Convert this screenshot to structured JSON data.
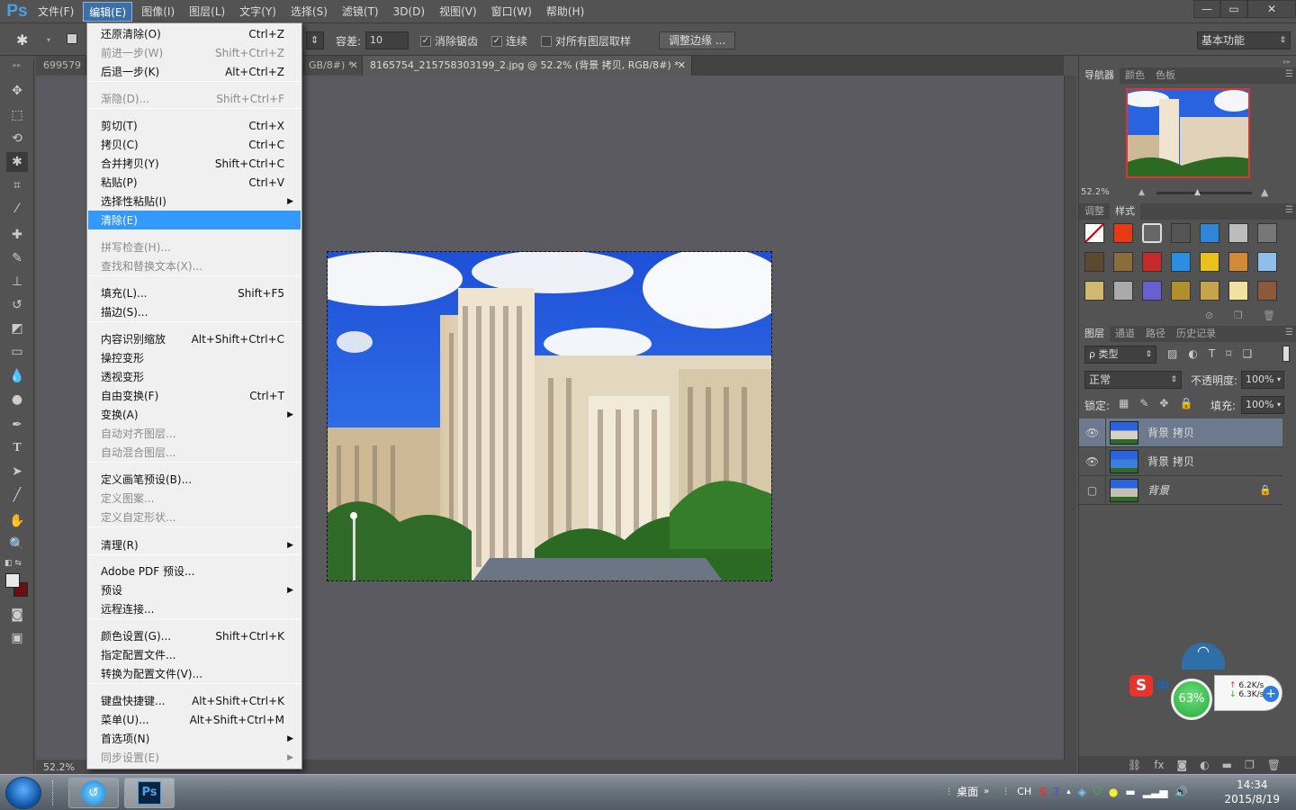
{
  "app": {
    "logo": "Ps"
  },
  "menubar": [
    "文件(F)",
    "编辑(E)",
    "图像(I)",
    "图层(L)",
    "文字(Y)",
    "选择(S)",
    "滤镜(T)",
    "3D(D)",
    "视图(V)",
    "窗口(W)",
    "帮助(H)"
  ],
  "window_controls": [
    "—",
    "▭",
    "✕"
  ],
  "options": {
    "tolerance_label": "容差:",
    "tolerance_value": "10",
    "antialias_label": "消除锯齿",
    "contiguous_label": "连续",
    "sample_all_label": "对所有图层取样",
    "refine_edge": "调整边缘 ...",
    "workspace": "基本功能"
  },
  "doc_tabs": [
    "699579",
    "GB/8#) *",
    "8165754_215758303199_2.jpg @ 52.2% (背景 拷贝, RGB/8#) *"
  ],
  "status": {
    "zoom": "52.2%"
  },
  "nav_panel": {
    "tabs": [
      "导航器",
      "颜色",
      "色板"
    ],
    "zoom": "52.2%"
  },
  "styles_panel": {
    "tabs": [
      "调整",
      "样式"
    ]
  },
  "layers_panel": {
    "tabs": [
      "图层",
      "通道",
      "路径",
      "历史记录"
    ],
    "kind_filter": "ρ 类型",
    "blend_mode": "正常",
    "opacity_label": "不透明度:",
    "opacity_value": "100%",
    "lock_label": "锁定:",
    "fill_label": "填充:",
    "fill_value": "100%",
    "layers": [
      {
        "name": "背景 拷贝",
        "visible": true,
        "selected": true
      },
      {
        "name": "背景 拷贝",
        "visible": true,
        "selected": false
      },
      {
        "name": "背景",
        "visible": false,
        "selected": false,
        "locked": true
      }
    ]
  },
  "edit_menu": {
    "items": [
      {
        "label": "还原清除(O)",
        "shortcut": "Ctrl+Z",
        "disabled": false
      },
      {
        "label": "前进一步(W)",
        "shortcut": "Shift+Ctrl+Z",
        "disabled": true
      },
      {
        "label": "后退一步(K)",
        "shortcut": "Alt+Ctrl+Z",
        "disabled": false
      },
      {
        "label": "渐隐(D)...",
        "shortcut": "Shift+Ctrl+F",
        "disabled": true
      },
      {
        "label": "剪切(T)",
        "shortcut": "Ctrl+X",
        "disabled": false
      },
      {
        "label": "拷贝(C)",
        "shortcut": "Ctrl+C",
        "disabled": false
      },
      {
        "label": "合并拷贝(Y)",
        "shortcut": "Shift+Ctrl+C",
        "disabled": false
      },
      {
        "label": "粘贴(P)",
        "shortcut": "Ctrl+V",
        "disabled": false
      },
      {
        "label": "选择性粘贴(I)",
        "shortcut": "",
        "disabled": false,
        "submenu": true
      },
      {
        "label": "清除(E)",
        "shortcut": "",
        "disabled": false,
        "highlighted": true
      },
      {
        "label": "拼写检查(H)...",
        "shortcut": "",
        "disabled": true
      },
      {
        "label": "查找和替换文本(X)...",
        "shortcut": "",
        "disabled": true
      },
      {
        "label": "填充(L)...",
        "shortcut": "Shift+F5",
        "disabled": false
      },
      {
        "label": "描边(S)...",
        "shortcut": "",
        "disabled": false
      },
      {
        "label": "内容识别缩放",
        "shortcut": "Alt+Shift+Ctrl+C",
        "disabled": false
      },
      {
        "label": "操控变形",
        "shortcut": "",
        "disabled": false
      },
      {
        "label": "透视变形",
        "shortcut": "",
        "disabled": false
      },
      {
        "label": "自由变换(F)",
        "shortcut": "Ctrl+T",
        "disabled": false
      },
      {
        "label": "变换(A)",
        "shortcut": "",
        "disabled": false,
        "submenu": true
      },
      {
        "label": "自动对齐图层...",
        "shortcut": "",
        "disabled": true
      },
      {
        "label": "自动混合图层...",
        "shortcut": "",
        "disabled": true
      },
      {
        "label": "定义画笔预设(B)...",
        "shortcut": "",
        "disabled": false
      },
      {
        "label": "定义图案...",
        "shortcut": "",
        "disabled": true
      },
      {
        "label": "定义自定形状...",
        "shortcut": "",
        "disabled": true
      },
      {
        "label": "清理(R)",
        "shortcut": "",
        "disabled": false,
        "submenu": true
      },
      {
        "label": "Adobe PDF 预设...",
        "shortcut": "",
        "disabled": false
      },
      {
        "label": "预设",
        "shortcut": "",
        "disabled": false,
        "submenu": true
      },
      {
        "label": "远程连接...",
        "shortcut": "",
        "disabled": false
      },
      {
        "label": "颜色设置(G)...",
        "shortcut": "Shift+Ctrl+K",
        "disabled": false
      },
      {
        "label": "指定配置文件...",
        "shortcut": "",
        "disabled": false
      },
      {
        "label": "转换为配置文件(V)...",
        "shortcut": "",
        "disabled": false
      },
      {
        "label": "键盘快捷键...",
        "shortcut": "Alt+Shift+Ctrl+K",
        "disabled": false
      },
      {
        "label": "菜单(U)...",
        "shortcut": "Alt+Shift+Ctrl+M",
        "disabled": false
      },
      {
        "label": "首选项(N)",
        "shortcut": "",
        "disabled": false,
        "submenu": true
      },
      {
        "label": "同步设置(E)",
        "shortcut": "",
        "disabled": true,
        "submenu": true
      }
    ]
  },
  "taskbar": {
    "desktop_label": "桌面",
    "lang": "CH",
    "time": "14:34",
    "date": "2015/8/19",
    "ps_label": "Ps"
  },
  "float_widget": {
    "percent": "63%",
    "up": "6.2K/s",
    "down": "6.3K/s",
    "ime": "中"
  }
}
